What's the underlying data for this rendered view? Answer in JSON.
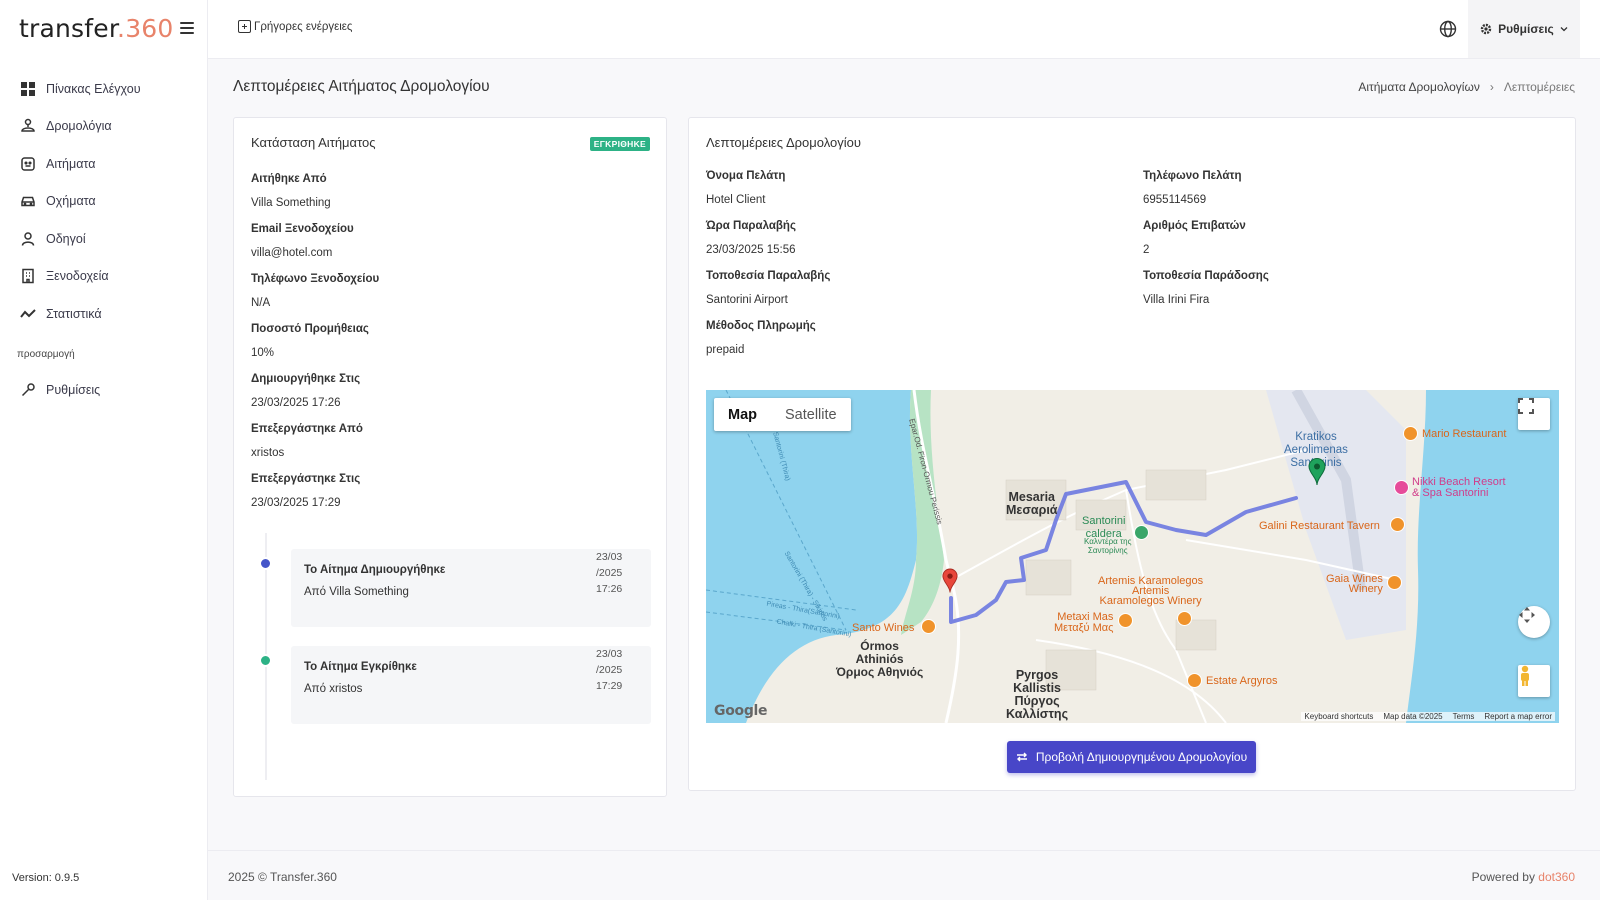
{
  "brand": {
    "name_a": "transfer",
    "name_b": ".360"
  },
  "sidebar": {
    "items": [
      {
        "label": "Πίνακας Ελέγχου",
        "icon": "dashboard-icon"
      },
      {
        "label": "Δρομολόγια",
        "icon": "route-icon"
      },
      {
        "label": "Αιτήματα",
        "icon": "request-icon"
      },
      {
        "label": "Οχήματα",
        "icon": "car-icon"
      },
      {
        "label": "Οδηγοί",
        "icon": "user-icon"
      },
      {
        "label": "Ξενοδοχεία",
        "icon": "building-icon"
      },
      {
        "label": "Στατιστικά",
        "icon": "stats-icon"
      }
    ],
    "section_label": "προσαρμογή",
    "settings_item": {
      "label": "Ρυθμίσεις",
      "icon": "wrench-icon"
    },
    "version": "Version: 0.9.5"
  },
  "topbar": {
    "quick_actions": "Γρήγορες ενέργειες",
    "settings": "Ρυθμίσεις"
  },
  "page": {
    "title": "Λεπτομέρειες Αιτήματος Δρομολογίου",
    "breadcrumb": [
      "Αιτήματα Δρομολογίων",
      "Λεπτομέρειες"
    ]
  },
  "request_status": {
    "title": "Κατάσταση Αιτήματος",
    "badge": "ΕΓΚΡΙΘΗΚΕ",
    "badge_color": "#2db286",
    "fields": [
      {
        "label": "Αιτήθηκε Από",
        "value": "Villa Something"
      },
      {
        "label": "Email Ξενοδοχείου",
        "value": "villa@hotel.com"
      },
      {
        "label": "Τηλέφωνο Ξενοδοχείου",
        "value": "N/A"
      },
      {
        "label": "Ποσοστό Προμήθειας",
        "value": "10%"
      },
      {
        "label": "Δημιουργήθηκε Στις",
        "value": "23/03/2025 17:26"
      },
      {
        "label": "Επεξεργάστηκε Από",
        "value": "xristos"
      },
      {
        "label": "Επεξεργάστηκε Στις",
        "value": "23/03/2025 17:29"
      }
    ],
    "timeline": [
      {
        "title": "Το Αίτημα Δημιουργήθηκε",
        "subtitle": "Από Villa Something",
        "date": "23/03 /2025 17:26",
        "color": "#4556c9"
      },
      {
        "title": "Το Αίτημα Εγκρίθηκε",
        "subtitle": "Από xristos",
        "date": "23/03 /2025 17:29",
        "color": "#2db286"
      }
    ]
  },
  "route_details": {
    "title": "Λεπτομέρειες Δρομολογίου",
    "fields_left": [
      {
        "label": "Όνομα Πελάτη",
        "value": "Hotel Client"
      },
      {
        "label": "Ώρα Παραλαβής",
        "value": "23/03/2025 15:56"
      },
      {
        "label": "Τοποθεσία Παραλαβής",
        "value": "Santorini Airport"
      },
      {
        "label": "Μέθοδος Πληρωμής",
        "value": "prepaid"
      }
    ],
    "fields_right": [
      {
        "label": "Τηλέφωνο Πελάτη",
        "value": "6955114569"
      },
      {
        "label": "Αριθμός Επιβατών",
        "value": "2"
      },
      {
        "label": "Τοποθεσία Παράδοσης",
        "value": "Villa Irini Fira"
      }
    ],
    "view_route_button": "Προβολή Δημιουργημένου Δρομολογίου"
  },
  "map": {
    "type_map": "Map",
    "type_satellite": "Satellite",
    "labels": {
      "mesaria": "Mesaria\nΜεσαριά",
      "ormos": "Órmos\nAthiniós\nΌρμος Αθηνιός",
      "pyrgos": "Pyrgos\nKallistis\nΠύργος\nΚαλλίστης",
      "airport": "Kratikos\nAerolimenas\nSantorinis",
      "caldera": "Santorini\ncaldera",
      "caldera_gr": "Καλντέρα της\nΣαντορίνης",
      "road": "Epar.Od. Firon-Ormou Perissis",
      "sea1": "Santorini (Thira)",
      "sea2": "Santorini (Thira) - Sikinos",
      "sea3": "Pireas - Thira(Santorini)",
      "sea4": "Chalki - Thira (Santorini)"
    },
    "pois": [
      {
        "name": "Mario Restaurant"
      },
      {
        "name": "Nikki Beach Resort\n& Spa Santorini"
      },
      {
        "name": "Galini Restaurant Tavern"
      },
      {
        "name": "Gaia Wines\nWinery"
      },
      {
        "name": "Artemis Karamolegos\nArtemis\nKaramolegos Winery"
      },
      {
        "name": "Metaxi Mas\nΜεταξύ Μας"
      },
      {
        "name": "Santo Wines"
      },
      {
        "name": "Estate Argyros"
      }
    ],
    "attribution": [
      "Keyboard shortcuts",
      "Map data ©2025",
      "Terms",
      "Report a map error"
    ],
    "logo": "Google"
  },
  "footer": {
    "copyright": "2025 © Transfer.360",
    "powered_by": "Powered by",
    "powered_brand": "dot360"
  }
}
